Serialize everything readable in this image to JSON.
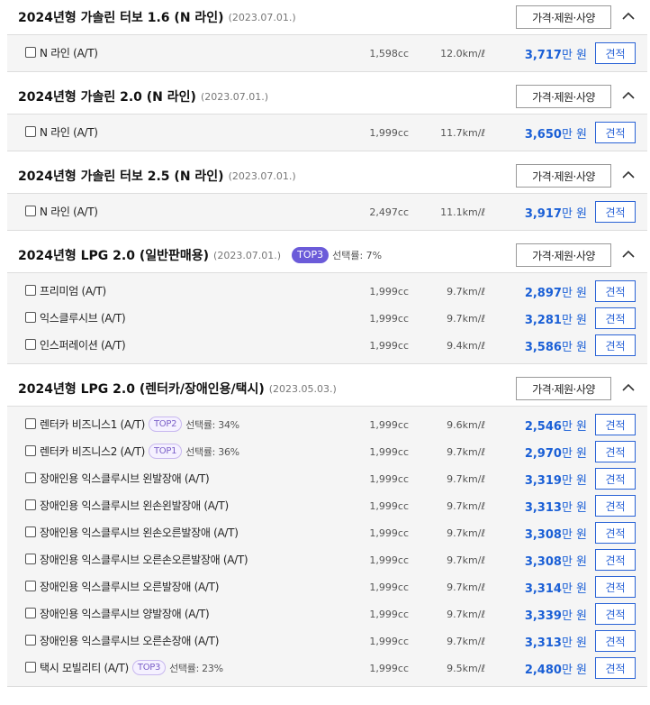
{
  "ui": {
    "spec_button": "가격·제원·사양",
    "quote_button": "견적",
    "price_unit": "만 원",
    "rate_prefix": "선택률:"
  },
  "sections": [
    {
      "title": "2024년형 가솔린 터보 1.6 (N 라인)",
      "date": "(2023.07.01.)",
      "trims": [
        {
          "name": "N 라인 (A/T)",
          "cc": "1,598cc",
          "eff": "12.0km/ℓ",
          "price": "3,717"
        }
      ]
    },
    {
      "title": "2024년형 가솔린 2.0 (N 라인)",
      "date": "(2023.07.01.)",
      "trims": [
        {
          "name": "N 라인 (A/T)",
          "cc": "1,999cc",
          "eff": "11.7km/ℓ",
          "price": "3,650"
        }
      ]
    },
    {
      "title": "2024년형 가솔린 터보 2.5 (N 라인)",
      "date": "(2023.07.01.)",
      "trims": [
        {
          "name": "N 라인 (A/T)",
          "cc": "2,497cc",
          "eff": "11.1km/ℓ",
          "price": "3,917"
        }
      ]
    },
    {
      "title": "2024년형 LPG 2.0 (일반판매용)",
      "date": "(2023.07.01.)",
      "badge": "TOP3",
      "rate": "선택률: 7%",
      "trims": [
        {
          "name": "프리미엄 (A/T)",
          "cc": "1,999cc",
          "eff": "9.7km/ℓ",
          "price": "2,897"
        },
        {
          "name": "익스클루시브 (A/T)",
          "cc": "1,999cc",
          "eff": "9.7km/ℓ",
          "price": "3,281"
        },
        {
          "name": "인스퍼레이션 (A/T)",
          "cc": "1,999cc",
          "eff": "9.4km/ℓ",
          "price": "3,586"
        }
      ]
    },
    {
      "title": "2024년형 LPG 2.0 (렌터카/장애인용/택시)",
      "date": "(2023.05.03.)",
      "trims": [
        {
          "name": "렌터카 비즈니스1 (A/T)",
          "badge": "TOP2",
          "rate": "선택률: 34%",
          "cc": "1,999cc",
          "eff": "9.6km/ℓ",
          "price": "2,546"
        },
        {
          "name": "렌터카 비즈니스2 (A/T)",
          "badge": "TOP1",
          "rate": "선택률: 36%",
          "cc": "1,999cc",
          "eff": "9.7km/ℓ",
          "price": "2,970"
        },
        {
          "name": "장애인용 익스클루시브 왼발장애 (A/T)",
          "cc": "1,999cc",
          "eff": "9.7km/ℓ",
          "price": "3,319"
        },
        {
          "name": "장애인용 익스클루시브 왼손왼발장애 (A/T)",
          "cc": "1,999cc",
          "eff": "9.7km/ℓ",
          "price": "3,313"
        },
        {
          "name": "장애인용 익스클루시브 왼손오른발장애 (A/T)",
          "cc": "1,999cc",
          "eff": "9.7km/ℓ",
          "price": "3,308"
        },
        {
          "name": "장애인용 익스클루시브 오른손오른발장애 (A/T)",
          "cc": "1,999cc",
          "eff": "9.7km/ℓ",
          "price": "3,308"
        },
        {
          "name": "장애인용 익스클루시브 오른발장애 (A/T)",
          "cc": "1,999cc",
          "eff": "9.7km/ℓ",
          "price": "3,314"
        },
        {
          "name": "장애인용 익스클루시브 양발장애 (A/T)",
          "cc": "1,999cc",
          "eff": "9.7km/ℓ",
          "price": "3,339"
        },
        {
          "name": "장애인용 익스클루시브 오른손장애 (A/T)",
          "cc": "1,999cc",
          "eff": "9.7km/ℓ",
          "price": "3,313"
        },
        {
          "name": "택시 모빌리티 (A/T)",
          "badge": "TOP3",
          "rate": "선택률: 23%",
          "cc": "1,999cc",
          "eff": "9.5km/ℓ",
          "price": "2,480"
        }
      ]
    }
  ]
}
